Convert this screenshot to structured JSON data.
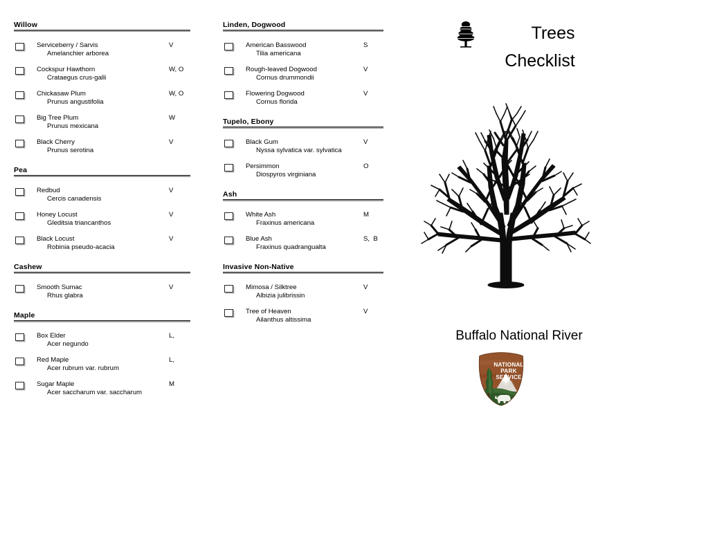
{
  "document": {
    "title_line_1": "Trees",
    "title_line_2": "Checklist",
    "park_name": "Buffalo National River",
    "conifer_icon": "conifer-tree-icon",
    "tree_illustration": "bare-deciduous-tree-silhouette",
    "nps_logo": "nps-arrowhead-logo",
    "nps_logo_text_lines": [
      "NATIONAL",
      "PARK",
      "SERVICE"
    ]
  },
  "colors": {
    "text": "#000000",
    "rule_dark": "#1a1a1a",
    "rule_gray": "#9a9a9a",
    "checkbox_border": "#262626",
    "checkbox_shadow": "#b0b0b0",
    "nps_brown": "#8a4a24",
    "nps_brown_light": "#a9653a",
    "nps_green": "#3c6b3c",
    "nps_green_dark": "#24491f",
    "nps_white": "#ffffff"
  },
  "columns": [
    {
      "id": "column-1",
      "sections": [
        {
          "header": "Willow",
          "entries": [
            {
              "common": "Serviceberry / Sarvis",
              "latin": "Amelanchier arborea",
              "code": "V"
            },
            {
              "common": "Cockspur Hawthorn",
              "latin": "Crataegus crus-galli",
              "code": "W, O"
            },
            {
              "common": "Chickasaw Plum",
              "latin": "Prunus angustifolia",
              "code": "W, O"
            },
            {
              "common": "Big Tree Plum",
              "latin": "Prunus mexicana",
              "code": "W"
            },
            {
              "common": "Black Cherry",
              "latin": "Prunus serotina",
              "code": "V"
            }
          ]
        },
        {
          "header": "Pea",
          "entries": [
            {
              "common": "Redbud",
              "latin": "Cercis canadensis",
              "code": "V"
            },
            {
              "common": "Honey Locust",
              "latin": "Gleditsia triancanthos",
              "code": "V"
            },
            {
              "common": "Black Locust",
              "latin": "Robinia pseudo-acacia",
              "code": "V"
            }
          ]
        },
        {
          "header": "Cashew",
          "entries": [
            {
              "common": "Smooth Sumac",
              "latin": "Rhus glabra",
              "code": "V"
            }
          ]
        },
        {
          "header": "Maple",
          "entries": [
            {
              "common": "Box Elder",
              "latin": "Acer negundo",
              "code": "L,"
            },
            {
              "common": "Red Maple",
              "latin": "Acer rubrum var. rubrum",
              "code": "L,"
            },
            {
              "common": "Sugar Maple",
              "latin": "Acer saccharum var. saccharum",
              "code": "M"
            }
          ]
        }
      ]
    },
    {
      "id": "column-2",
      "sections": [
        {
          "header": "Linden, Dogwood",
          "entries": [
            {
              "common": "American Basswood",
              "latin": "Tilia americana",
              "code": "S"
            },
            {
              "common": "Rough-leaved Dogwood",
              "latin": "Cornus drummondii",
              "code": "V"
            },
            {
              "common": "Flowering Dogwood",
              "latin": "Cornus florida",
              "code": "V"
            }
          ]
        },
        {
          "header": "Tupelo, Ebony",
          "entries": [
            {
              "common": "Black Gum",
              "latin": "Nyssa sylvatica var. sylvatica",
              "code": "V"
            },
            {
              "common": "Persimmon",
              "latin": "Diospyros virginiana",
              "code": "O"
            }
          ]
        },
        {
          "header": "Ash",
          "entries": [
            {
              "common": "White Ash",
              "latin": "Fraxinus americana",
              "code": "M"
            },
            {
              "common": "Blue Ash",
              "latin": "Fraxinus quadrangualta",
              "code": "S,  B"
            }
          ]
        },
        {
          "header": "Invasive Non-Native",
          "entries": [
            {
              "common": "Mimosa / Silktree",
              "latin": "Albizia julibrissin",
              "code": "V"
            },
            {
              "common": "Tree of Heaven",
              "latin": "Ailanthus altissima",
              "code": "V"
            }
          ]
        }
      ]
    }
  ]
}
